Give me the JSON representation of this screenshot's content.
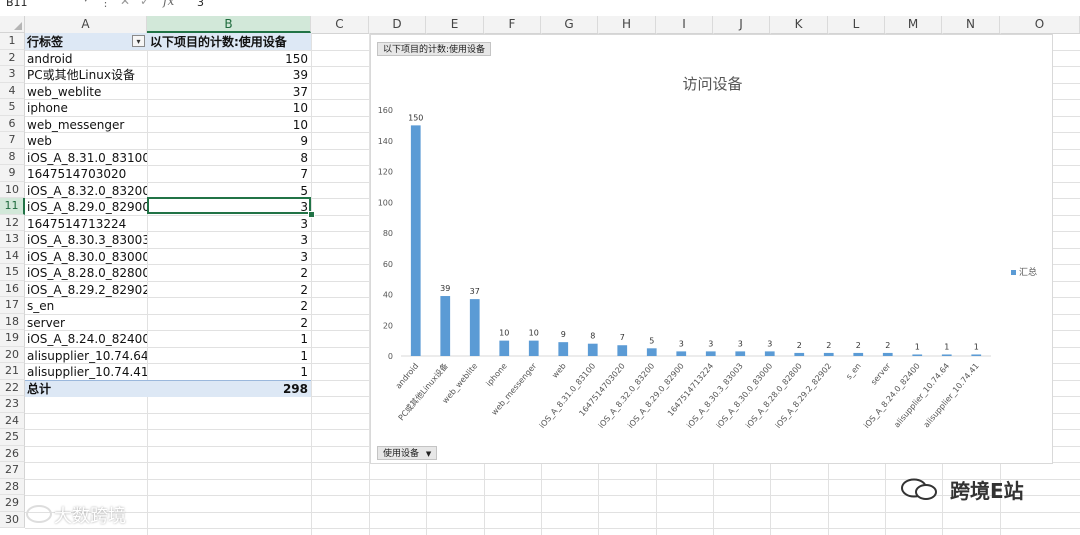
{
  "formula_bar": {
    "name_box": "B11",
    "formula_value": "3"
  },
  "columns": [
    "A",
    "B",
    "C",
    "D",
    "E",
    "F",
    "G",
    "H",
    "I",
    "J",
    "K",
    "L",
    "M",
    "N",
    "O"
  ],
  "rows": [
    "1",
    "2",
    "3",
    "4",
    "5",
    "6",
    "7",
    "8",
    "9",
    "10",
    "11",
    "12",
    "13",
    "14",
    "15",
    "16",
    "17",
    "18",
    "19",
    "20",
    "21",
    "22",
    "23",
    "24",
    "25",
    "26",
    "27",
    "28",
    "29",
    "30"
  ],
  "pivot": {
    "header_label": "行标签",
    "header_value": "以下项目的计数:使用设备",
    "items": [
      {
        "label": "android",
        "value": "150"
      },
      {
        "label": "PC或其他Linux设备",
        "value": "39"
      },
      {
        "label": "web_weblite",
        "value": "37"
      },
      {
        "label": "iphone",
        "value": "10"
      },
      {
        "label": "web_messenger",
        "value": "10"
      },
      {
        "label": "web",
        "value": "9"
      },
      {
        "label": "iOS_A_8.31.0_83100",
        "value": "8"
      },
      {
        "label": "1647514703020",
        "value": "7"
      },
      {
        "label": "iOS_A_8.32.0_83200",
        "value": "5"
      },
      {
        "label": "iOS_A_8.29.0_82900",
        "value": "3"
      },
      {
        "label": "1647514713224",
        "value": "3"
      },
      {
        "label": "iOS_A_8.30.3_83003",
        "value": "3"
      },
      {
        "label": "iOS_A_8.30.0_83000",
        "value": "3"
      },
      {
        "label": "iOS_A_8.28.0_82800",
        "value": "2"
      },
      {
        "label": "iOS_A_8.29.2_82902",
        "value": "2"
      },
      {
        "label": "s_en",
        "value": "2"
      },
      {
        "label": "server",
        "value": "2"
      },
      {
        "label": "iOS_A_8.24.0_82400",
        "value": "1"
      },
      {
        "label": "alisupplier_10.74.64",
        "value": "1"
      },
      {
        "label": "alisupplier_10.74.41",
        "value": "1"
      }
    ],
    "total_label": "总计",
    "total_value": "298"
  },
  "chart": {
    "value_field_button": "以下项目的计数:使用设备",
    "axis_field_button": "使用设备",
    "axis_field_dropdown": "▼",
    "legend_label": "汇总"
  },
  "chart_data": {
    "type": "bar",
    "title": "访问设备",
    "categories": [
      "android",
      "PC或其他Linux设备",
      "web_weblite",
      "iphone",
      "web_messenger",
      "web",
      "iOS_A_8.31.0_83100",
      "1647514703020",
      "iOS_A_8.32.0_83200",
      "iOS_A_8.29.0_82900",
      "1647514713224",
      "iOS_A_8.30.3_83003",
      "iOS_A_8.30.0_83000",
      "iOS_A_8.28.0_82800",
      "iOS_A_8.29.2_82902",
      "s_en",
      "server",
      "iOS_A_8.24.0_82400",
      "alisupplier_10.74.64",
      "alisupplier_10.74.41"
    ],
    "series": [
      {
        "name": "汇总",
        "values": [
          150,
          39,
          37,
          10,
          10,
          9,
          8,
          7,
          5,
          3,
          3,
          3,
          3,
          2,
          2,
          2,
          2,
          1,
          1,
          1
        ]
      }
    ],
    "ylim": [
      0,
      160
    ],
    "yticks": [
      0,
      20,
      40,
      60,
      80,
      100,
      120,
      140,
      160
    ],
    "grid": false,
    "legend_position": "right",
    "bar_color": "#5b9bd5"
  },
  "watermarks": {
    "left": "大数跨境",
    "right": "跨境E站"
  }
}
